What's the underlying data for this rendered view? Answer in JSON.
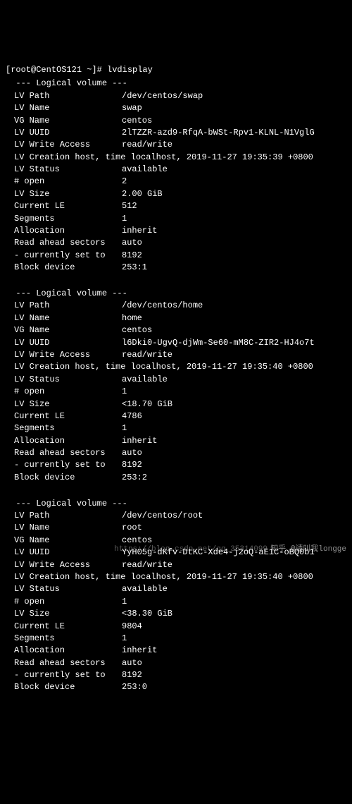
{
  "prompt": "[root@CentOS121 ~]# lvdisplay",
  "section_header": "  --- Logical volume ---",
  "labels": {
    "lv_path": "LV Path",
    "lv_name": "LV Name",
    "vg_name": "VG Name",
    "lv_uuid": "LV UUID",
    "lv_write_access": "LV Write Access",
    "lv_creation": "LV Creation host, time",
    "lv_status": "LV Status",
    "open": "# open",
    "lv_size": "LV Size",
    "current_le": "Current LE",
    "segments": "Segments",
    "allocation": "Allocation",
    "read_ahead": "Read ahead sectors",
    "currently_set": "- currently set to",
    "block_device": "Block device"
  },
  "volumes": [
    {
      "lv_path": "/dev/centos/swap",
      "lv_name": "swap",
      "vg_name": "centos",
      "lv_uuid": "2lTZZR-azd9-RfqA-bWSt-Rpv1-KLNL-N1VglG",
      "lv_write_access": "read/write",
      "lv_creation": "localhost, 2019-11-27 19:35:39 +0800",
      "lv_status": "available",
      "open": "2",
      "lv_size": "2.00 GiB",
      "current_le": "512",
      "segments": "1",
      "allocation": "inherit",
      "read_ahead": "auto",
      "currently_set": "8192",
      "block_device": "253:1"
    },
    {
      "lv_path": "/dev/centos/home",
      "lv_name": "home",
      "vg_name": "centos",
      "lv_uuid": "l6Dki0-UgvQ-djWm-Se60-mM8C-ZIR2-HJ4o7t",
      "lv_write_access": "read/write",
      "lv_creation": "localhost, 2019-11-27 19:35:40 +0800",
      "lv_status": "available",
      "open": "1",
      "lv_size": "<18.70 GiB",
      "current_le": "4786",
      "segments": "1",
      "allocation": "inherit",
      "read_ahead": "auto",
      "currently_set": "8192",
      "block_device": "253:2"
    },
    {
      "lv_path": "/dev/centos/root",
      "lv_name": "root",
      "vg_name": "centos",
      "lv_uuid": "YyH05g-dKfv-DtKC-Xde4-j2oQ-aE1C-oBQ0b1",
      "lv_write_access": "read/write",
      "lv_creation": "localhost, 2019-11-27 19:35:40 +0800",
      "lv_status": "available",
      "open": "1",
      "lv_size": "<38.30 GiB",
      "current_le": "9804",
      "segments": "1",
      "allocation": "inherit",
      "read_ahead": "auto",
      "currently_set": "8192",
      "block_device": "253:0"
    }
  ],
  "watermark": "知乎 @请叫我longge",
  "watermark2": "https://blog.csdn.net/qq_35314099"
}
